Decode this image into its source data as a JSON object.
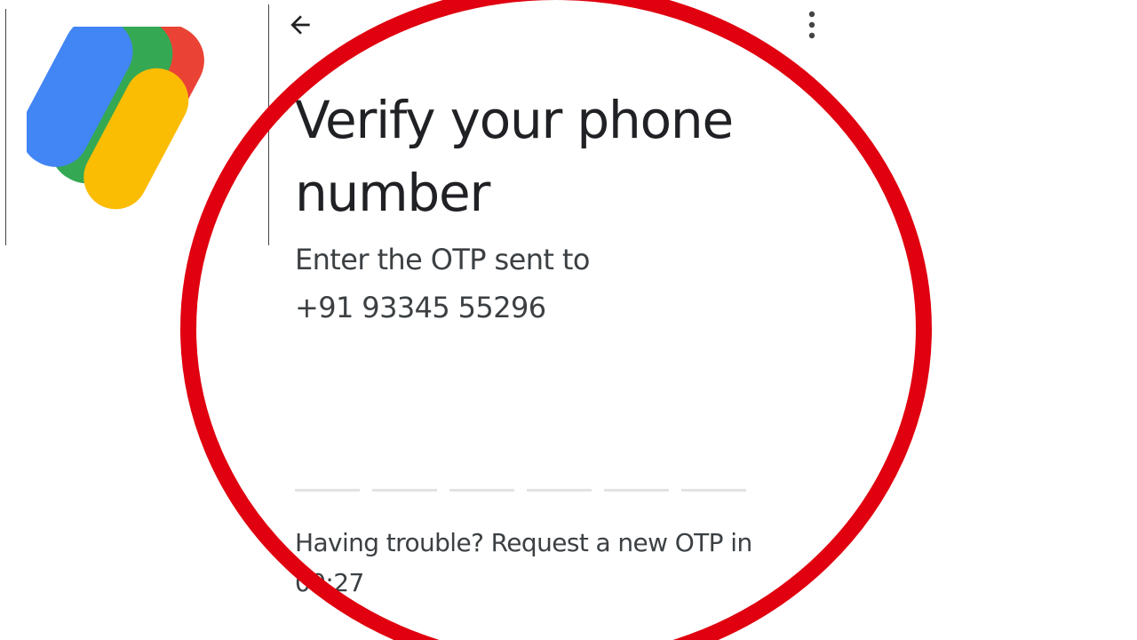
{
  "logo": {
    "colors": {
      "blue": "#4285F4",
      "green": "#34A853",
      "yellow": "#FBBC04",
      "red": "#EA4335"
    }
  },
  "toolbar": {
    "back_icon": "arrow-back-icon",
    "more_icon": "more-vert-icon"
  },
  "main": {
    "title": "Verify your phone number",
    "subtitle": "Enter the OTP sent to",
    "phone_number": "+91 93345 55296",
    "otp_slots": [
      "",
      "",
      "",
      "",
      "",
      ""
    ],
    "trouble_text": "Having trouble? Request a new OTP in",
    "timer": "00:27"
  },
  "annotation": {
    "ring_color": "#E0000F"
  }
}
